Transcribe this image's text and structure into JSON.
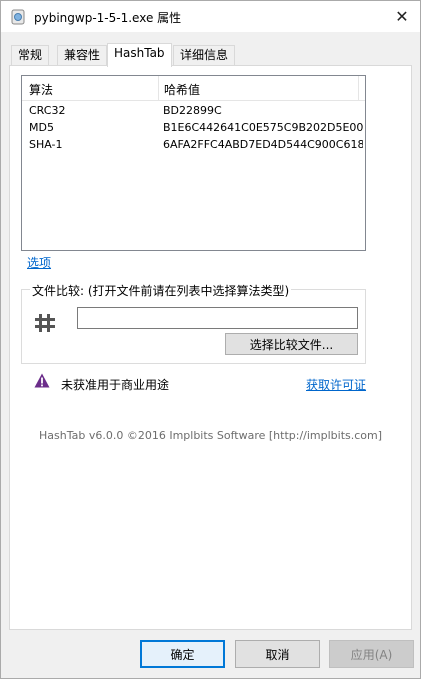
{
  "window": {
    "title": "pybingwp-1-5-1.exe 属性",
    "close_glyph": "✕"
  },
  "tabs": [
    {
      "label": "常规"
    },
    {
      "label": "兼容性"
    },
    {
      "label": "HashTab",
      "active": true
    },
    {
      "label": "详细信息"
    }
  ],
  "hash_list": {
    "headers": [
      "算法",
      "哈希值"
    ],
    "rows": [
      {
        "algorithm": "CRC32",
        "value": "BD22899C"
      },
      {
        "algorithm": "MD5",
        "value": "B1E6C442641C0E575C9B202D5E00..."
      },
      {
        "algorithm": "SHA-1",
        "value": "6AFA2FFC4ABD7ED4D544C900C618..."
      }
    ]
  },
  "options_link": "选项",
  "compare": {
    "group_label": "文件比较: (打开文件前请在列表中选择算法类型)",
    "input_value": "",
    "button_label": "选择比较文件..."
  },
  "notice": {
    "text": "未获准用于商业用途",
    "link": "获取许可证"
  },
  "footer": "HashTab v6.0.0 ©2016 Implbits Software [http://implbits.com]",
  "buttons": {
    "ok": "确定",
    "cancel": "取消",
    "apply": "应用(A)"
  },
  "colors": {
    "link": "#0066cc",
    "default_button_border": "#0078d7",
    "warning_icon": "#6b2d8a"
  },
  "icons": {
    "title": "exe-file-icon",
    "hash": "hash-icon",
    "warning": "warning-icon"
  }
}
